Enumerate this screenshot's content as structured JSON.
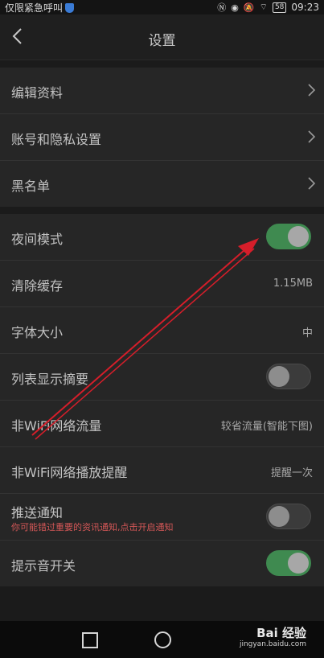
{
  "status_bar": {
    "carrier": "仅限紧急呼叫",
    "battery": "58",
    "time": "09:23"
  },
  "header": {
    "title": "设置",
    "back_icon": "chevron-left-icon"
  },
  "groups": [
    {
      "items": [
        {
          "label": "编辑资料",
          "icon": "chevron-right-icon"
        },
        {
          "label": "账号和隐私设置",
          "icon": "chevron-right-icon"
        },
        {
          "label": "黑名单",
          "icon": "chevron-right-icon"
        }
      ]
    },
    {
      "items": [
        {
          "label": "夜间模式",
          "toggle": true
        },
        {
          "label": "清除缓存",
          "value": "1.15MB"
        },
        {
          "label": "字体大小",
          "value": "中"
        },
        {
          "label": "列表显示摘要",
          "toggle": false
        },
        {
          "label": "非WiFi网络流量",
          "value": "较省流量(智能下图)"
        },
        {
          "label": "非WiFi网络播放提醒",
          "value": "提醒一次"
        },
        {
          "label": "推送通知",
          "sublabel": "你可能错过重要的资讯通知,点击开启通知",
          "toggle": false
        },
        {
          "label": "提示音开关",
          "toggle": true
        }
      ]
    }
  ],
  "watermark": {
    "brand": "Bai 经验",
    "url": "jingyan.baidu.com"
  },
  "colors": {
    "toggle_on": "#3f8a50",
    "toggle_off": "#3b3b3b",
    "annotation_arrow": "#d61e2a",
    "notice_text": "#d45757"
  }
}
